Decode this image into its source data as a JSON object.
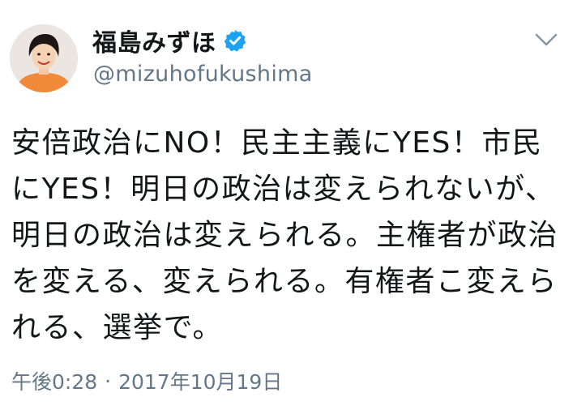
{
  "user": {
    "display_name": "福島みずほ",
    "handle": "@mizuhofukushima",
    "verified_icon": "verified-badge-icon",
    "accent_color": "#1da1f2"
  },
  "menu": {
    "icon": "chevron-down-icon"
  },
  "tweet": {
    "text": "安倍政治にNO！民主主義にYES！市民\nにYES！明日の政治は変えられないが、\n明日の政治は変えられる。主権者が政治\nを変える、変えられる。有権者こ変えら\nれる、選挙で。"
  },
  "meta": {
    "time": "午後0:28",
    "separator": "·",
    "date": "2017年10月19日"
  }
}
